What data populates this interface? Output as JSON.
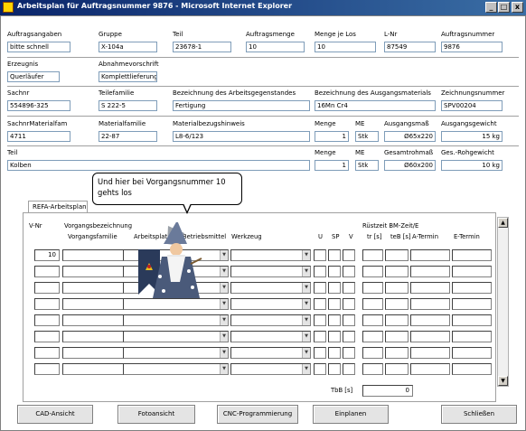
{
  "window": {
    "title": "Arbeitsplan für Auftragsnummer 9876 - Microsoft Internet Explorer",
    "controls": [
      "_",
      "□",
      "x"
    ]
  },
  "row1": [
    {
      "label": "Auftragsangaben",
      "value": "bitte schnell"
    },
    {
      "label": "Gruppe",
      "value": "X-104a"
    },
    {
      "label": "Teil",
      "value": "23678-1"
    },
    {
      "label": "Auftragsmenge",
      "value": "10"
    },
    {
      "label": "Menge je Los",
      "value": "10"
    },
    {
      "label": "L-Nr",
      "value": "87549"
    },
    {
      "label": "Auftragsnummer",
      "value": "9876"
    }
  ],
  "row2": [
    {
      "label": "Erzeugnis",
      "value": "Querläufer"
    },
    {
      "label": "Abnahmevorschrift",
      "value": "Komplettlieferung"
    }
  ],
  "row3": [
    {
      "label": "Sachnr",
      "value": "554896-325"
    },
    {
      "label": "Teilefamilie",
      "value": "S 222-5"
    },
    {
      "label": "Bezeichnung des Arbeitsgegenstandes",
      "value": "Fertigung"
    },
    {
      "label": "Bezeichnung des Ausgangsmaterials",
      "value": "16Mn Cr4"
    },
    {
      "label": "Zeichnungsnummer",
      "value": "SPV00204"
    }
  ],
  "row4": [
    {
      "label": "SachnrMaterialfam",
      "value": "4711"
    },
    {
      "label": "Materialfamilie",
      "value": "22-87"
    },
    {
      "label": "Materialbezugshinweis",
      "value": "L8-6/123"
    },
    {
      "label": "Menge",
      "value": "1"
    },
    {
      "label": "ME",
      "value": "Stk"
    },
    {
      "label": "Ausgangsmaß",
      "value": "Ø65x220"
    },
    {
      "label": "Ausgangsgewicht",
      "value": "15 kg"
    }
  ],
  "row5": [
    {
      "label": "Teil",
      "value": "Kolben"
    },
    {
      "label": "Menge",
      "value": "1"
    },
    {
      "label": "ME",
      "value": "Stk"
    },
    {
      "label": "Gesamtrohmaß",
      "value": "Ø60x200"
    },
    {
      "label": "Ges.-Rohgewicht",
      "value": "10 kg"
    }
  ],
  "tab": {
    "label": "REFA-Arbeitsplan"
  },
  "bubble": {
    "text": "Und hier bei Vorgangsnummer 10 gehts los"
  },
  "grid": {
    "headers_top": {
      "vnr": "V-Nr",
      "vorgangsbezeichnung": "Vorgangsbezeichnung",
      "ruestzeit": "Rüstzeit BM-Zeit/E"
    },
    "headers": {
      "vorgangsfamilie": "Vorgangsfamilie",
      "arbeitsplatz": "Arbeitsplatz",
      "betriebsmittel": "Betriebsmittel",
      "werkzeug": "Werkzeug",
      "u": "U",
      "sp": "SP",
      "v": "V",
      "tr": "tr [s]",
      "teb": "teB [s]",
      "atermin": "A-Termin",
      "etermin": "E-Termin"
    },
    "rows": [
      {
        "vnr": "10"
      },
      {
        "vnr": ""
      },
      {
        "vnr": ""
      },
      {
        "vnr": ""
      },
      {
        "vnr": ""
      },
      {
        "vnr": ""
      },
      {
        "vnr": ""
      },
      {
        "vnr": ""
      }
    ],
    "tbb_label": "TbB [s]",
    "tbb_value": "0"
  },
  "buttons": {
    "cad": "CAD-Ansicht",
    "foto": "Fotoansicht",
    "cnc": "CNC-Programmierung",
    "einplanen": "Einplanen",
    "schliessen": "Schließen"
  }
}
